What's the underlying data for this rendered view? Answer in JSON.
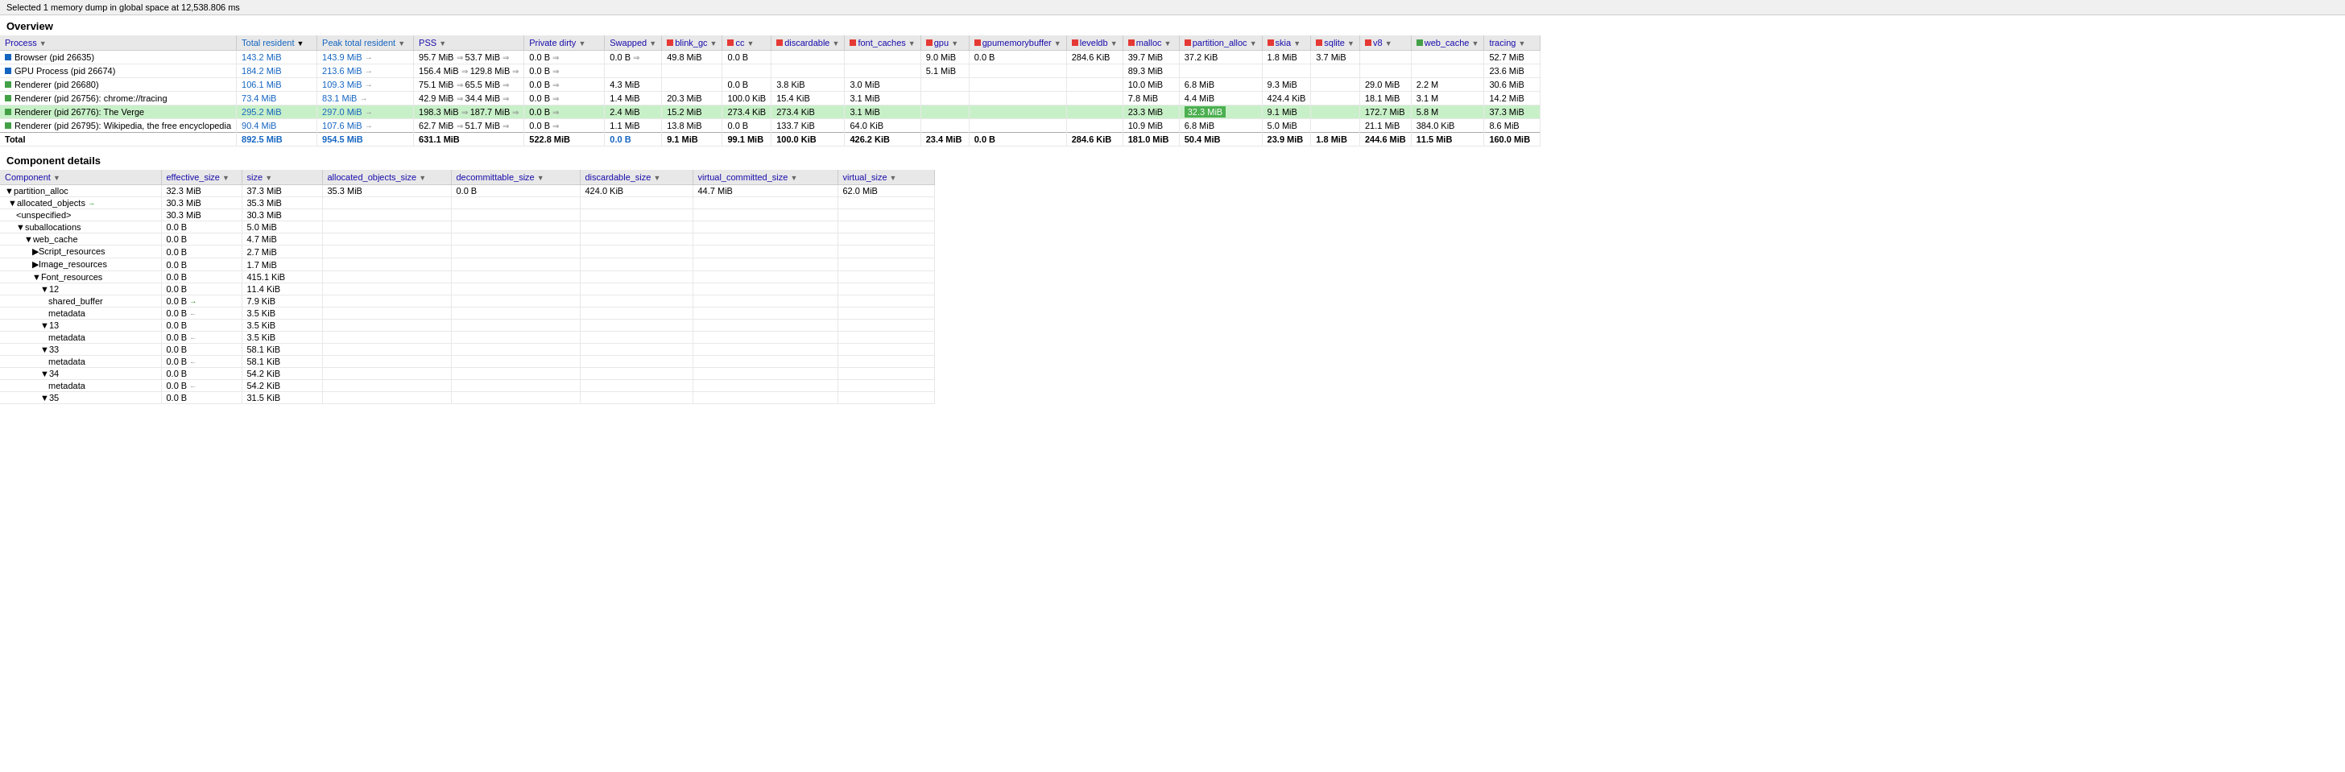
{
  "statusBar": {
    "text": "Selected 1 memory dump in global space at 12,538.806 ms"
  },
  "overview": {
    "title": "Overview",
    "tableHeaders": [
      {
        "id": "process",
        "label": "Process",
        "sortable": true
      },
      {
        "id": "total_resident",
        "label": "Total resident",
        "sortable": true,
        "color": "#1565C0"
      },
      {
        "id": "peak_total_resident",
        "label": "Peak total resident",
        "sortable": true,
        "color": "#1565C0"
      },
      {
        "id": "pss",
        "label": "PSS",
        "sortable": true
      },
      {
        "id": "private_dirty",
        "label": "Private dirty",
        "sortable": true
      },
      {
        "id": "swapped",
        "label": "Swapped",
        "sortable": true
      },
      {
        "id": "blink_gc",
        "label": "blink_gc",
        "sortable": true,
        "color": "#e53935"
      },
      {
        "id": "cc",
        "label": "cc",
        "sortable": true,
        "color": "#e53935"
      },
      {
        "id": "discardable",
        "label": "discardable",
        "sortable": true,
        "color": "#e53935"
      },
      {
        "id": "font_caches",
        "label": "font_caches",
        "sortable": true,
        "color": "#e53935"
      },
      {
        "id": "gpu",
        "label": "gpu",
        "sortable": true,
        "color": "#e53935"
      },
      {
        "id": "gpumemorybuffer",
        "label": "gpumemorybuffer",
        "sortable": true,
        "color": "#e53935"
      },
      {
        "id": "leveldb",
        "label": "leveldb",
        "sortable": true,
        "color": "#e53935"
      },
      {
        "id": "malloc",
        "label": "malloc",
        "sortable": true,
        "color": "#e53935"
      },
      {
        "id": "partition_alloc",
        "label": "partition_alloc",
        "sortable": true,
        "color": "#e53935"
      },
      {
        "id": "skia",
        "label": "skia",
        "sortable": true,
        "color": "#e53935"
      },
      {
        "id": "sqlite",
        "label": "sqlite",
        "sortable": true,
        "color": "#e53935"
      },
      {
        "id": "v8",
        "label": "v8",
        "sortable": true,
        "color": "#e53935"
      },
      {
        "id": "web_cache",
        "label": "web_cache",
        "sortable": true,
        "color": "#43a047"
      },
      {
        "id": "tracing",
        "label": "tracing",
        "sortable": true
      }
    ],
    "rows": [
      {
        "process": "Browser (pid 26635)",
        "color": "#1565C0",
        "total_resident": "143.2 MiB",
        "peak_total_resident": "143.9 MiB",
        "peak_arrow": "→",
        "pss": "95.7 MiB",
        "pss_arrow": "⇒",
        "pss2": "53.7 MiB",
        "pss_arrow2": "⇒",
        "private_dirty": "0.0 B",
        "private_dirty_arrow": "⇒",
        "swapped": "0.0 B",
        "swapped_arrow": "⇒",
        "blink_gc": "49.8 MiB",
        "cc": "0.0 B",
        "discardable": "",
        "font_caches": "",
        "gpu": "9.0 MiB",
        "gpumemorybuffer": "0.0 B",
        "leveldb": "284.6 KiB",
        "malloc": "39.7 MiB",
        "partition_alloc": "37.2 KiB",
        "skia": "1.8 MiB",
        "sqlite": "3.7 MiB",
        "web_cache": "",
        "tracing": "52.7 MiB",
        "highlighted": false
      },
      {
        "process": "GPU Process (pid 26674)",
        "color": "#1565C0",
        "total_resident": "184.2 MiB",
        "peak_total_resident": "213.6 MiB",
        "peak_arrow": "→",
        "pss": "156.4 MiB",
        "pss_arrow": "⇒",
        "pss2": "129.8 MiB",
        "pss_arrow2": "⇒",
        "private_dirty": "0.0 B",
        "private_dirty_arrow": "⇒",
        "swapped": "",
        "blink_gc": "",
        "cc": "",
        "discardable": "",
        "font_caches": "",
        "gpu": "5.1 MiB",
        "gpumemorybuffer": "",
        "leveldb": "",
        "malloc": "89.3 MiB",
        "partition_alloc": "",
        "skia": "",
        "sqlite": "",
        "web_cache": "",
        "tracing": "23.6 MiB",
        "highlighted": false
      },
      {
        "process": "Renderer (pid 26680)",
        "color": "#43a047",
        "total_resident": "106.1 MiB",
        "peak_total_resident": "109.3 MiB",
        "peak_arrow": "→",
        "pss": "75.1 MiB",
        "pss_arrow": "⇒",
        "pss2": "65.5 MiB",
        "pss_arrow2": "⇒",
        "private_dirty": "0.0 B",
        "private_dirty_arrow": "⇒",
        "swapped": "4.3 MiB",
        "blink_gc": "",
        "cc": "0.0 B",
        "discardable": "3.8 KiB",
        "font_caches": "3.0 MiB",
        "gpu": "",
        "gpumemorybuffer": "",
        "leveldb": "",
        "malloc": "10.0 MiB",
        "partition_alloc": "6.8 MiB",
        "skia": "9.3 MiB",
        "sqlite": "",
        "web_cache": "29.0 MiB",
        "tracing": "2.2 M",
        "tracing2": "30.6 MiB",
        "highlighted": false
      },
      {
        "process": "Renderer (pid 26756): chrome://tracing",
        "color": "#43a047",
        "total_resident": "73.4 MiB",
        "peak_total_resident": "83.1 MiB",
        "peak_arrow": "→",
        "pss": "42.9 MiB",
        "pss_arrow": "⇒",
        "pss2": "34.4 MiB",
        "pss_arrow2": "⇒",
        "private_dirty": "0.0 B",
        "private_dirty_arrow": "⇒",
        "swapped": "1.4 MiB",
        "blink_gc": "20.3 MiB",
        "cc": "100.0 KiB",
        "discardable": "15.4 KiB",
        "font_caches": "3.1 MiB",
        "gpu": "",
        "gpumemorybuffer": "",
        "leveldb": "",
        "malloc": "7.8 MiB",
        "partition_alloc": "4.4 MiB",
        "skia": "424.4 KiB",
        "sqlite": "",
        "web_cache": "18.1 MiB",
        "tracing": "3.1 M",
        "tracing2": "14.2 MiB",
        "highlighted": false
      },
      {
        "process": "Renderer (pid 26776): The Verge",
        "color": "#43a047",
        "total_resident": "295.2 MiB",
        "peak_total_resident": "297.0 MiB",
        "peak_arrow": "→",
        "pss": "198.3 MiB",
        "pss_arrow": "⇒",
        "pss2": "187.7 MiB",
        "pss_arrow2": "⇒",
        "private_dirty": "0.0 B",
        "private_dirty_arrow": "⇒",
        "swapped": "2.4 MiB",
        "blink_gc": "15.2 MiB",
        "cc": "273.4 KiB",
        "discardable": "273.4 KiB",
        "font_caches": "3.1 MiB",
        "gpu": "",
        "gpumemorybuffer": "",
        "leveldb": "",
        "malloc": "23.3 MiB",
        "partition_alloc_highlighted": "32.3 MiB",
        "partition_alloc": "",
        "skia": "9.1 MiB",
        "sqlite": "",
        "web_cache": "172.7 MiB",
        "tracing": "5.8 M",
        "tracing2": "37.3 MiB",
        "highlighted": true
      },
      {
        "process": "Renderer (pid 26795): Wikipedia, the free encyclopedia",
        "color": "#43a047",
        "total_resident": "90.4 MiB",
        "peak_total_resident": "107.6 MiB",
        "peak_arrow": "→",
        "pss": "62.7 MiB",
        "pss_arrow": "⇒",
        "pss2": "51.7 MiB",
        "pss_arrow2": "⇒",
        "private_dirty": "0.0 B",
        "private_dirty_arrow": "⇒",
        "swapped": "1.1 MiB",
        "blink_gc": "13.8 MiB",
        "cc": "0.0 B",
        "discardable": "133.7 KiB",
        "font_caches": "64.0 KiB",
        "gpu": "",
        "gpumemorybuffer": "",
        "leveldb": "",
        "malloc": "10.9 MiB",
        "partition_alloc": "6.8 MiB",
        "skia": "5.0 MiB",
        "sqlite": "",
        "web_cache": "21.1 MiB",
        "tracing": "384.0 KiB",
        "tracing2": "8.6 MiB",
        "highlighted": false
      }
    ],
    "totalRow": {
      "label": "Total",
      "total_resident": "892.5 MiB",
      "peak_total_resident": "954.5 MiB",
      "pss": "631.1 MiB",
      "private_dirty": "522.8 MiB",
      "swapped": "0.0 B",
      "blink_gc": "9.1 MiB",
      "cc": "99.1 MiB",
      "discardable": "100.0 KiB",
      "font_caches": "426.2 KiB",
      "gpu": "23.4 MiB",
      "gpumemorybuffer": "0.0 B",
      "leveldb": "284.6 KiB",
      "malloc": "181.0 MiB",
      "partition_alloc": "50.4 MiB",
      "skia": "23.9 MiB",
      "sqlite": "1.8 MiB",
      "v8": "244.6 MiB",
      "web_cache": "11.5 MiB",
      "tracing": "160.0 MiB"
    }
  },
  "componentDetails": {
    "title": "Component details",
    "tableHeaders": [
      {
        "id": "component",
        "label": "Component",
        "sortable": true
      },
      {
        "id": "effective_size",
        "label": "effective_size",
        "sortable": true
      },
      {
        "id": "size",
        "label": "size",
        "sortable": true
      },
      {
        "id": "allocated_objects_size",
        "label": "allocated_objects_size",
        "sortable": true
      },
      {
        "id": "decommittable_size",
        "label": "decommittable_size",
        "sortable": true
      },
      {
        "id": "discardable_size",
        "label": "discardable_size",
        "sortable": true
      },
      {
        "id": "virtual_committed_size",
        "label": "virtual_committed_size",
        "sortable": true
      },
      {
        "id": "virtual_size",
        "label": "virtual_size",
        "sortable": true
      }
    ],
    "rows": [
      {
        "component": "▼partition_alloc",
        "indent": 0,
        "effective_size": "32.3 MiB",
        "size": "37.3 MiB",
        "allocated_objects_size": "35.3 MiB",
        "decommittable_size": "0.0 B",
        "discardable_size": "424.0 KiB",
        "virtual_committed_size": "44.7 MiB",
        "virtual_size": "62.0 MiB"
      },
      {
        "component": "▼allocated_objects",
        "indent": 1,
        "effective_size": "30.3 MiB",
        "size": "35.3 MiB",
        "allocated_objects_size": "",
        "decommittable_size": "",
        "discardable_size": "",
        "virtual_committed_size": "",
        "virtual_size": "",
        "green_arrow": true
      },
      {
        "component": "<unspecified>",
        "indent": 2,
        "effective_size": "30.3 MiB",
        "size": "30.3 MiB",
        "allocated_objects_size": "",
        "decommittable_size": "",
        "discardable_size": "",
        "virtual_committed_size": "",
        "virtual_size": ""
      },
      {
        "component": "▼suballocations",
        "indent": 2,
        "effective_size": "0.0 B",
        "size": "5.0 MiB",
        "allocated_objects_size": "",
        "decommittable_size": "",
        "discardable_size": "",
        "virtual_committed_size": "",
        "virtual_size": ""
      },
      {
        "component": "▼web_cache",
        "indent": 3,
        "effective_size": "0.0 B",
        "size": "4.7 MiB",
        "allocated_objects_size": "",
        "decommittable_size": "",
        "discardable_size": "",
        "virtual_committed_size": "",
        "virtual_size": ""
      },
      {
        "component": "▶Script_resources",
        "indent": 4,
        "effective_size": "0.0 B",
        "size": "2.7 MiB",
        "allocated_objects_size": "",
        "decommittable_size": "",
        "discardable_size": "",
        "virtual_committed_size": "",
        "virtual_size": ""
      },
      {
        "component": "▶Image_resources",
        "indent": 4,
        "effective_size": "0.0 B",
        "size": "1.7 MiB",
        "allocated_objects_size": "",
        "decommittable_size": "",
        "discardable_size": "",
        "virtual_committed_size": "",
        "virtual_size": ""
      },
      {
        "component": "▼Font_resources",
        "indent": 4,
        "effective_size": "0.0 B",
        "size": "415.1 KiB",
        "allocated_objects_size": "",
        "decommittable_size": "",
        "discardable_size": "",
        "virtual_committed_size": "",
        "virtual_size": ""
      },
      {
        "component": "▼12",
        "indent": 5,
        "effective_size": "0.0 B",
        "size": "11.4 KiB",
        "allocated_objects_size": "",
        "decommittable_size": "",
        "discardable_size": "",
        "virtual_committed_size": "",
        "virtual_size": ""
      },
      {
        "component": "shared_buffer",
        "indent": 6,
        "effective_size": "0.0 B",
        "size": "7.9 KiB",
        "allocated_objects_size": "",
        "decommittable_size": "",
        "discardable_size": "",
        "virtual_committed_size": "",
        "virtual_size": "",
        "green_arrow": true
      },
      {
        "component": "metadata",
        "indent": 6,
        "effective_size": "0.0 B",
        "size": "3.5 KiB",
        "allocated_objects_size": "",
        "decommittable_size": "",
        "discardable_size": "",
        "virtual_committed_size": "",
        "virtual_size": "",
        "left_arrow": true
      },
      {
        "component": "▼13",
        "indent": 5,
        "effective_size": "0.0 B",
        "size": "3.5 KiB",
        "allocated_objects_size": "",
        "decommittable_size": "",
        "discardable_size": "",
        "virtual_committed_size": "",
        "virtual_size": ""
      },
      {
        "component": "metadata",
        "indent": 6,
        "effective_size": "0.0 B",
        "size": "3.5 KiB",
        "allocated_objects_size": "",
        "decommittable_size": "",
        "discardable_size": "",
        "virtual_committed_size": "",
        "virtual_size": "",
        "left_arrow": true
      },
      {
        "component": "▼33",
        "indent": 5,
        "effective_size": "0.0 B",
        "size": "58.1 KiB",
        "allocated_objects_size": "",
        "decommittable_size": "",
        "discardable_size": "",
        "virtual_committed_size": "",
        "virtual_size": ""
      },
      {
        "component": "metadata",
        "indent": 6,
        "effective_size": "0.0 B",
        "size": "58.1 KiB",
        "allocated_objects_size": "",
        "decommittable_size": "",
        "discardable_size": "",
        "virtual_committed_size": "",
        "virtual_size": "",
        "left_arrow": true
      },
      {
        "component": "▼34",
        "indent": 5,
        "effective_size": "0.0 B",
        "size": "54.2 KiB",
        "allocated_objects_size": "",
        "decommittable_size": "",
        "discardable_size": "",
        "virtual_committed_size": "",
        "virtual_size": ""
      },
      {
        "component": "metadata",
        "indent": 6,
        "effective_size": "0.0 B",
        "size": "54.2 KiB",
        "allocated_objects_size": "",
        "decommittable_size": "",
        "discardable_size": "",
        "virtual_committed_size": "",
        "virtual_size": "",
        "left_arrow": true
      },
      {
        "component": "▼35",
        "indent": 5,
        "effective_size": "0.0 B",
        "size": "31.5 KiB",
        "allocated_objects_size": "",
        "decommittable_size": "",
        "discardable_size": "",
        "virtual_committed_size": "",
        "virtual_size": ""
      }
    ]
  },
  "scrollbar": {
    "present": true
  }
}
